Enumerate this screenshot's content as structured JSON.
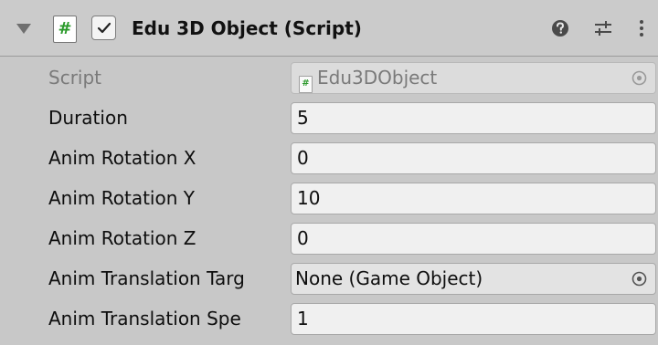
{
  "component": {
    "title": "Edu 3D Object (Script)",
    "script_icon_glyph": "#",
    "enabled": true
  },
  "header_icons": {
    "fold": "triangle-down-icon",
    "help": "help-icon",
    "presets": "presets-icon",
    "menu": "kebab-menu-icon"
  },
  "fields": [
    {
      "label": "Script",
      "value": "Edu3DObject",
      "kind": "object",
      "disabled": true
    },
    {
      "label": "Duration",
      "value": "5",
      "kind": "number"
    },
    {
      "label": "Anim Rotation X",
      "value": "0",
      "kind": "number"
    },
    {
      "label": "Anim Rotation Y",
      "value": "10",
      "kind": "number"
    },
    {
      "label": "Anim Rotation Z",
      "value": "0",
      "kind": "number"
    },
    {
      "label": "Anim Translation Targ",
      "value": "None (Game Object)",
      "kind": "object"
    },
    {
      "label": "Anim Translation Spe",
      "value": "1",
      "kind": "number"
    }
  ],
  "colors": {
    "panel_bg": "#c8c8c8",
    "field_bg": "#f0f0f0",
    "script_hash": "#2a9a2a"
  }
}
